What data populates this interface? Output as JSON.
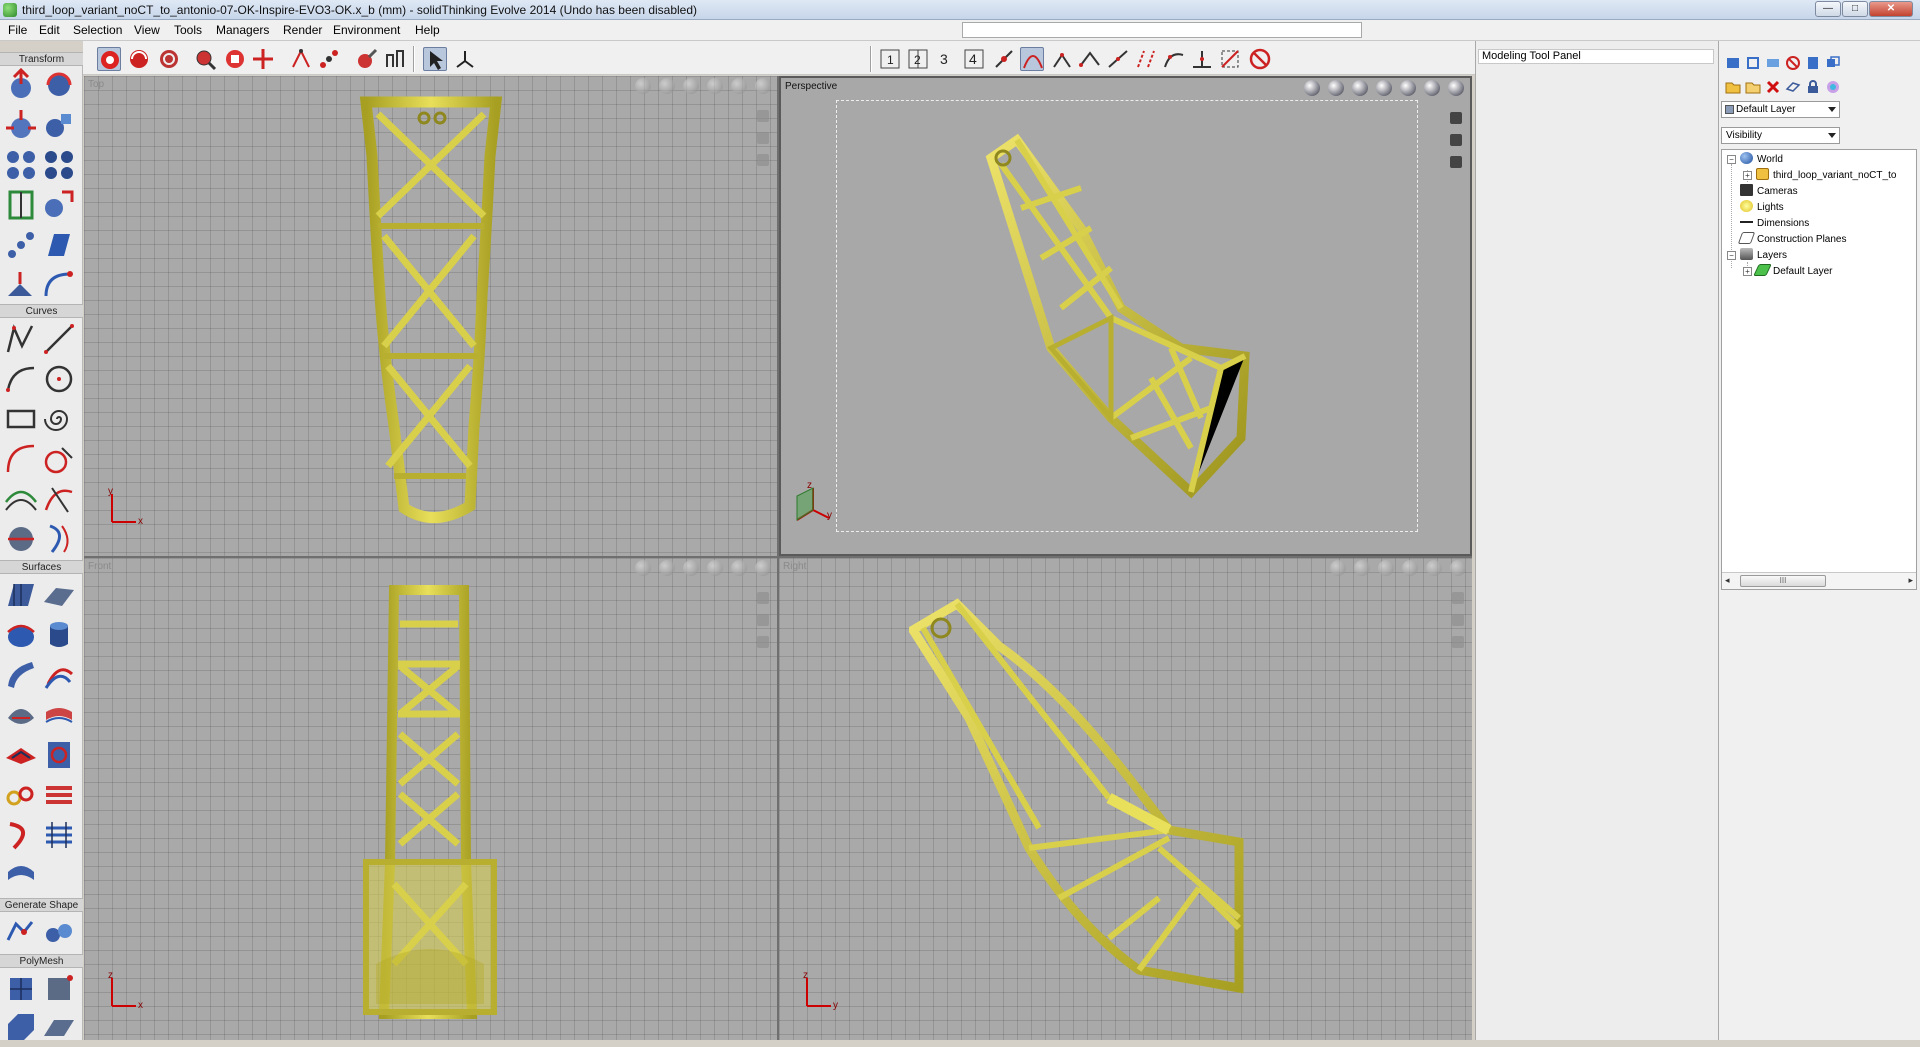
{
  "window": {
    "title": "third_loop_variant_noCT_to_antonio-07-OK-Inspire-EVO3-OK.x_b (mm) - solidThinking Evolve 2014 (Undo has been disabled)",
    "minimize": "—",
    "maximize": "□",
    "close": "✕"
  },
  "menu": [
    "File",
    "Edit",
    "Selection",
    "View",
    "Tools",
    "Managers",
    "Render",
    "Environment",
    "Help"
  ],
  "palette": {
    "sections": [
      "Transform",
      "Curves",
      "Surfaces",
      "Generate Shape",
      "PolyMesh"
    ]
  },
  "toolbar_main": {
    "numbered_buttons": [
      "1",
      "2",
      "3",
      "4"
    ]
  },
  "viewports": {
    "top_left": {
      "label": "Top",
      "axis_h": "x",
      "axis_v": "y"
    },
    "top_right": {
      "label": "Perspective",
      "axis_a": "z",
      "axis_b": "y"
    },
    "bottom_left": {
      "label": "Front",
      "axis_h": "x",
      "axis_v": "z"
    },
    "bottom_right": {
      "label": "Right",
      "axis_h": "y",
      "axis_v": "z"
    }
  },
  "modeling_panel": {
    "title": "Modeling Tool Panel"
  },
  "browser": {
    "layer_combo": "Default Layer",
    "filter_combo": "Visibility",
    "tree": {
      "world": "World",
      "object": "third_loop_variant_noCT_to",
      "cameras": "Cameras",
      "lights": "Lights",
      "dimensions": "Dimensions",
      "construction_planes": "Construction Planes",
      "layers": "Layers",
      "default_layer": "Default Layer"
    },
    "scroll_thumb": "III"
  },
  "colors": {
    "model": "#d8cf4a",
    "model_dark": "#a79f22",
    "viewport_bg": "#a9a9a9"
  }
}
